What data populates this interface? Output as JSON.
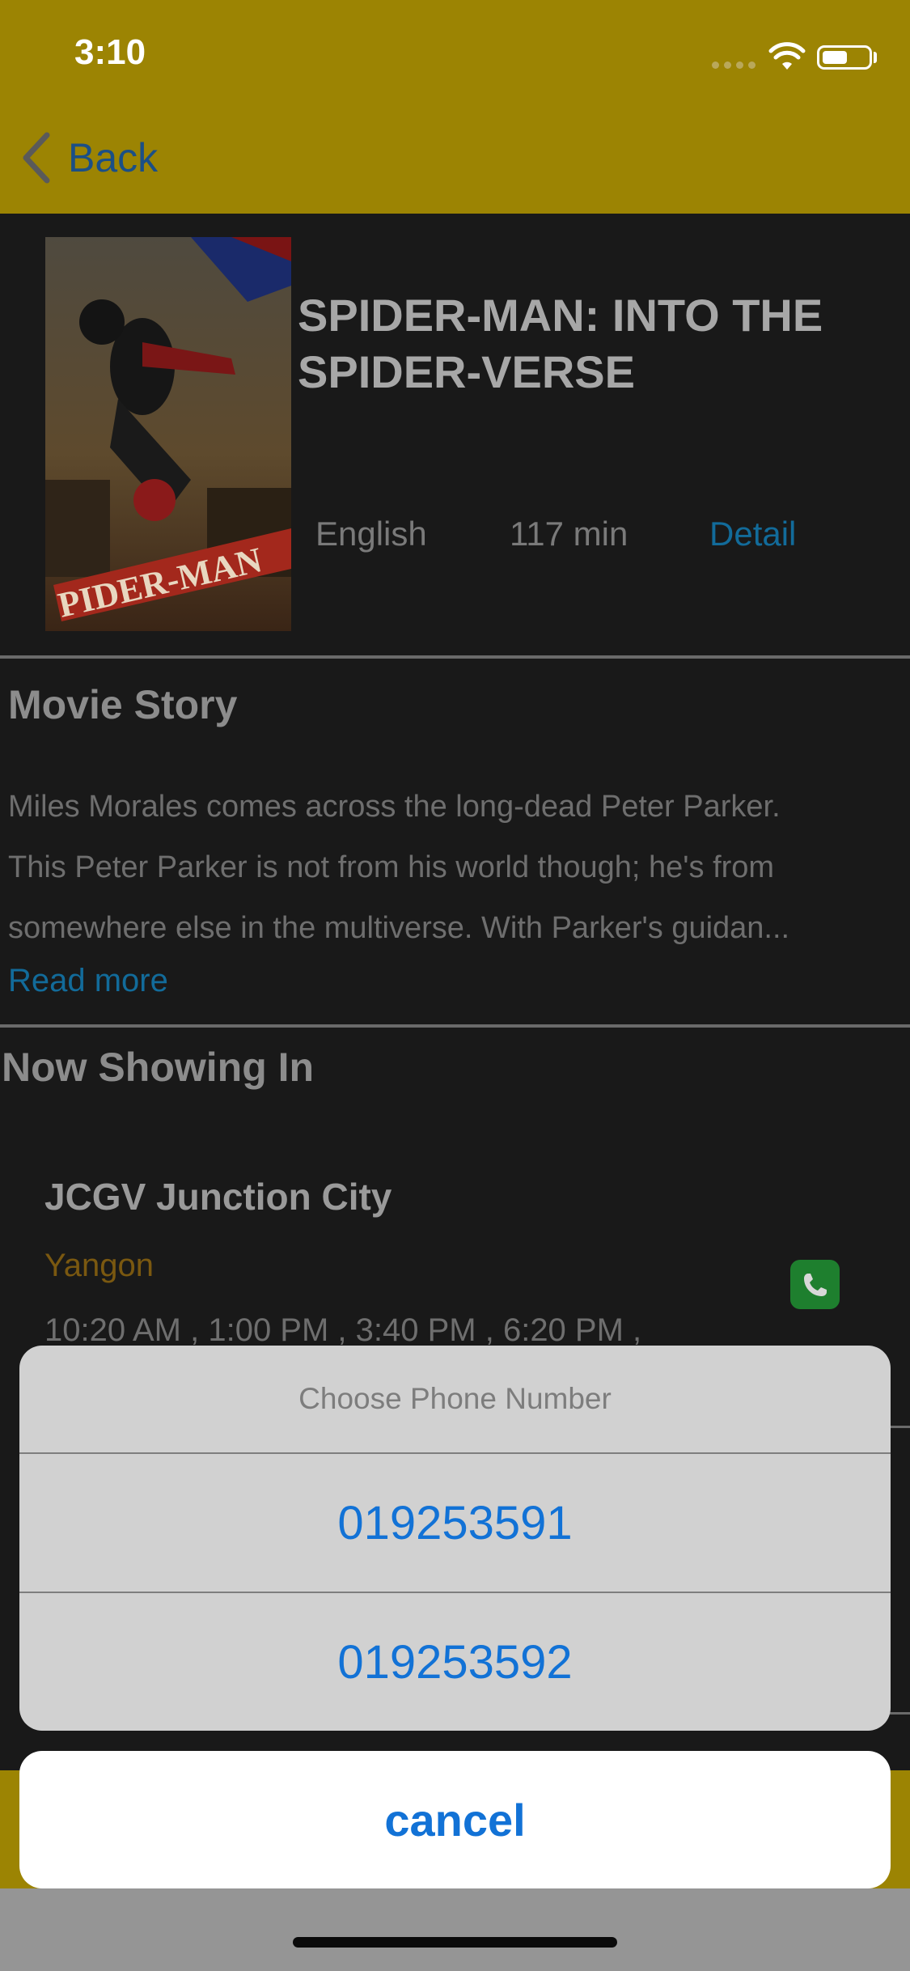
{
  "status_bar": {
    "time": "3:10"
  },
  "nav": {
    "back_label": "Back"
  },
  "movie": {
    "title": "SPIDER-MAN: INTO THE SPIDER-VERSE",
    "language": "English",
    "duration": "117 min",
    "detail_label": "Detail"
  },
  "story": {
    "heading": "Movie Story",
    "lines": [
      "Miles Morales comes across the long-dead Peter Parker.",
      "This Peter Parker is not from his world though; he's from",
      "somewhere else in the multiverse. With Parker's guidan..."
    ],
    "read_more": "Read more"
  },
  "showing": {
    "heading": "Now Showing In",
    "cinema": {
      "name": "JCGV Junction City",
      "city": "Yangon",
      "times": "10:20 AM ,  1:00 PM ,  3:40 PM ,  6:20 PM ,"
    }
  },
  "action_sheet": {
    "title": "Choose Phone Number",
    "options": [
      "019253591",
      "019253592"
    ],
    "cancel_label": "cancel"
  },
  "colors": {
    "nav_bar": "#9c8403",
    "link": "#126b9a",
    "action_blue": "#1272d6",
    "phone_green": "#1e7f2e"
  }
}
